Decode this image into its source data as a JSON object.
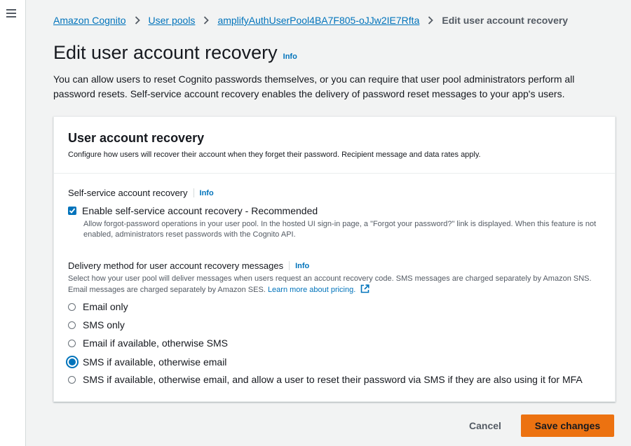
{
  "breadcrumb": {
    "items": [
      "Amazon Cognito",
      "User pools",
      "amplifyAuthUserPool4BA7F805-oJJw2IE7Rfta"
    ],
    "current": "Edit user account recovery"
  },
  "page": {
    "title": "Edit user account recovery",
    "info": "Info",
    "description": "You can allow users to reset Cognito passwords themselves, or you can require that user pool administrators perform all password resets. Self-service account recovery enables the delivery of password reset messages to your app's users."
  },
  "panel": {
    "title": "User account recovery",
    "description": "Configure how users will recover their account when they forget their password. Recipient message and data rates apply.",
    "self_service": {
      "label": "Self-service account recovery",
      "info": "Info",
      "checkbox_label": "Enable self-service account recovery - Recommended",
      "checked": true,
      "help": "Allow forgot-password operations in your user pool. In the hosted UI sign-in page, a \"Forgot your password?\" link is displayed. When this feature is not enabled, administrators reset passwords with the Cognito API."
    },
    "delivery": {
      "label": "Delivery method for user account recovery messages",
      "info": "Info",
      "description": "Select how your user pool will deliver messages when users request an account recovery code. SMS messages are charged separately by Amazon SNS. Email messages are charged separately by Amazon SES.",
      "learn_more": "Learn more about pricing.",
      "options": [
        "Email only",
        "SMS only",
        "Email if available, otherwise SMS",
        "SMS if available, otherwise email",
        "SMS if available, otherwise email, and allow a user to reset their password via SMS if they are also using it for MFA"
      ],
      "selected": "SMS if available, otherwise email"
    }
  },
  "actions": {
    "cancel": "Cancel",
    "save": "Save changes"
  },
  "colors": {
    "accent": "#0073bb",
    "primary_button": "#ec7211",
    "background": "#f2f3f3"
  },
  "icons": [
    "menu-icon",
    "chevron-right-icon",
    "checkmark-icon",
    "external-link-icon"
  ]
}
